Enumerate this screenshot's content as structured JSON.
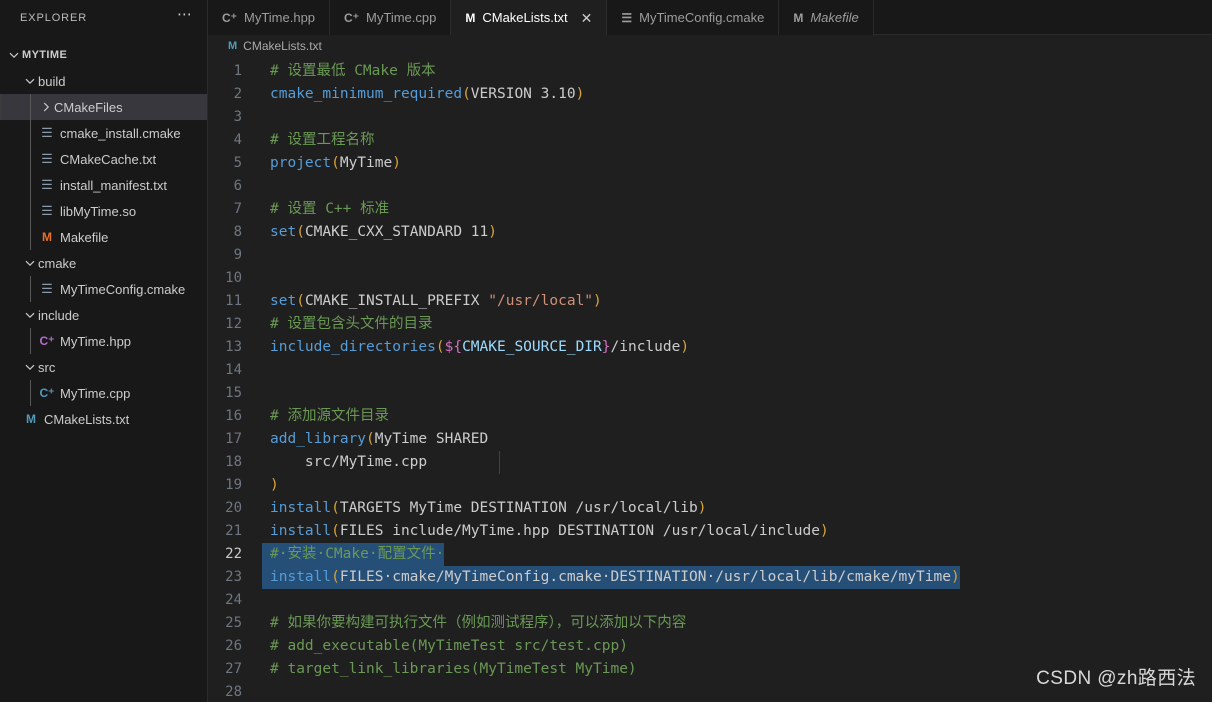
{
  "sidebar": {
    "header_title": "EXPLORER",
    "more_icon": "ellipsis-icon",
    "root": {
      "label": "MYTIME",
      "chevron": "chevron-down-icon"
    },
    "items": [
      {
        "label": "build",
        "type": "folder",
        "chevron": "chevron-down-icon",
        "indent": 1,
        "icon": "",
        "icon_kind": ""
      },
      {
        "label": "CMakeFiles",
        "type": "folder",
        "chevron": "chevron-right-icon",
        "indent": 2,
        "icon": "",
        "icon_kind": "",
        "selected": true
      },
      {
        "label": "cmake_install.cmake",
        "type": "file",
        "indent": 2,
        "icon": "☰",
        "icon_kind": "txt"
      },
      {
        "label": "CMakeCache.txt",
        "type": "file",
        "indent": 2,
        "icon": "☰",
        "icon_kind": "txt"
      },
      {
        "label": "install_manifest.txt",
        "type": "file",
        "indent": 2,
        "icon": "☰",
        "icon_kind": "txt"
      },
      {
        "label": "libMyTime.so",
        "type": "file",
        "indent": 2,
        "icon": "☰",
        "icon_kind": "txt"
      },
      {
        "label": "Makefile",
        "type": "file",
        "indent": 2,
        "icon": "M",
        "icon_kind": "mk-orange"
      },
      {
        "label": "cmake",
        "type": "folder",
        "chevron": "chevron-down-icon",
        "indent": 1,
        "icon": "",
        "icon_kind": ""
      },
      {
        "label": "MyTimeConfig.cmake",
        "type": "file",
        "indent": 2,
        "icon": "☰",
        "icon_kind": "txt"
      },
      {
        "label": "include",
        "type": "folder",
        "chevron": "chevron-down-icon",
        "indent": 1,
        "icon": "",
        "icon_kind": ""
      },
      {
        "label": "MyTime.hpp",
        "type": "file",
        "indent": 2,
        "icon": "C⁺",
        "icon_kind": "cpp-purple"
      },
      {
        "label": "src",
        "type": "folder",
        "chevron": "chevron-down-icon",
        "indent": 1,
        "icon": "",
        "icon_kind": ""
      },
      {
        "label": "MyTime.cpp",
        "type": "file",
        "indent": 2,
        "icon": "C⁺",
        "icon_kind": "cpp-blue"
      },
      {
        "label": "CMakeLists.txt",
        "type": "file",
        "indent": 1,
        "icon": "M",
        "icon_kind": "mk-blue"
      }
    ]
  },
  "tabs": [
    {
      "label": "MyTime.hpp",
      "icon": "C⁺",
      "icon_kind": "cpp-purple",
      "active": false,
      "preview": false
    },
    {
      "label": "MyTime.cpp",
      "icon": "C⁺",
      "icon_kind": "cpp-blue",
      "active": false,
      "preview": false
    },
    {
      "label": "CMakeLists.txt",
      "icon": "M",
      "icon_kind": "mk-blue",
      "active": true,
      "preview": false,
      "close_glyph": "✕"
    },
    {
      "label": "MyTimeConfig.cmake",
      "icon": "☰",
      "icon_kind": "txt",
      "active": false,
      "preview": false
    },
    {
      "label": "Makefile",
      "icon": "M",
      "icon_kind": "mk-orange",
      "active": false,
      "preview": true
    }
  ],
  "breadcrumb": {
    "icon": "M",
    "label": "CMakeLists.txt"
  },
  "editor": {
    "active_line": 22,
    "selected_lines": [
      22,
      23
    ],
    "lines": [
      {
        "n": 1,
        "text": "# 设置最低 CMake 版本"
      },
      {
        "n": 2,
        "text": "cmake_minimum_required(VERSION 3.10)"
      },
      {
        "n": 3,
        "text": ""
      },
      {
        "n": 4,
        "text": "# 设置工程名称"
      },
      {
        "n": 5,
        "text": "project(MyTime)"
      },
      {
        "n": 6,
        "text": ""
      },
      {
        "n": 7,
        "text": "# 设置 C++ 标准"
      },
      {
        "n": 8,
        "text": "set(CMAKE_CXX_STANDARD 11)"
      },
      {
        "n": 9,
        "text": ""
      },
      {
        "n": 10,
        "text": ""
      },
      {
        "n": 11,
        "text": "set(CMAKE_INSTALL_PREFIX \"/usr/local\")"
      },
      {
        "n": 12,
        "text": "# 设置包含头文件的目录"
      },
      {
        "n": 13,
        "text": "include_directories(${CMAKE_SOURCE_DIR}/include)"
      },
      {
        "n": 14,
        "text": ""
      },
      {
        "n": 15,
        "text": ""
      },
      {
        "n": 16,
        "text": "# 添加源文件目录"
      },
      {
        "n": 17,
        "text": "add_library(MyTime SHARED"
      },
      {
        "n": 18,
        "text": "    src/MyTime.cpp"
      },
      {
        "n": 19,
        "text": ")"
      },
      {
        "n": 20,
        "text": "install(TARGETS MyTime DESTINATION /usr/local/lib)"
      },
      {
        "n": 21,
        "text": "install(FILES include/MyTime.hpp DESTINATION /usr/local/include)"
      },
      {
        "n": 22,
        "text": "# 安装 CMake 配置文件 "
      },
      {
        "n": 23,
        "text": "install(FILES cmake/MyTimeConfig.cmake DESTINATION /usr/local/lib/cmake/myTime)"
      },
      {
        "n": 24,
        "text": ""
      },
      {
        "n": 25,
        "text": "# 如果你要构建可执行文件（例如测试程序），可以添加以下内容"
      },
      {
        "n": 26,
        "text": "# add_executable(MyTimeTest src/test.cpp)"
      },
      {
        "n": 27,
        "text": "# target_link_libraries(MyTimeTest MyTime)"
      },
      {
        "n": 28,
        "text": ""
      }
    ]
  },
  "watermark": {
    "text": "CSDN @zh路西法"
  },
  "colors": {
    "editor_bg": "#1f1f1f",
    "sidebar_bg": "#181818",
    "tabbar_bg": "#181818",
    "selection": "#264f78",
    "comment": "#6a9955",
    "function": "#569cd6",
    "paren": "#d7a33a",
    "string": "#ce9178",
    "variable": "#9cdcfe",
    "accent_cpp_purple": "#b36dcf",
    "accent_cpp_blue": "#519aba",
    "accent_makefile": "#e8702a"
  }
}
